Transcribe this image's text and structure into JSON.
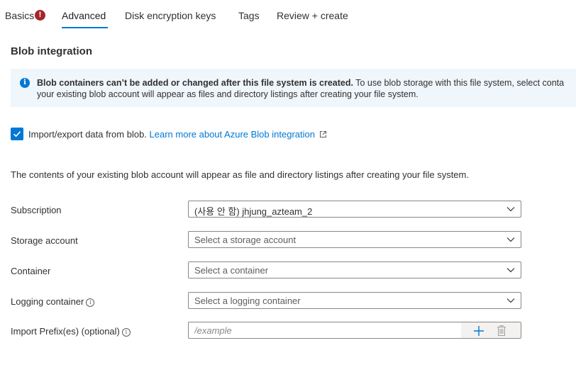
{
  "tabs": [
    {
      "label": "Basics",
      "has_error": true
    },
    {
      "label": "Advanced",
      "selected": true
    },
    {
      "label": "Disk encryption keys"
    },
    {
      "label": "Tags"
    },
    {
      "label": "Review + create"
    }
  ],
  "error_badge": "!",
  "section_title": "Blob integration",
  "banner": {
    "icon": "info-icon",
    "bold_text": "Blob containers can’t be added or changed after this file system is created.",
    "text_line1": " To use blob storage with this file system, select conta",
    "text_line2": "your existing blob account will appear as files and directory listings after creating your file system."
  },
  "import_export": {
    "checked": true,
    "label": "Import/export data from blob. ",
    "link": "Learn more about Azure Blob integration"
  },
  "description": "The contents of your existing blob account will appear as file and directory listings after creating your file system.",
  "form": {
    "subscription": {
      "label": "Subscription",
      "value": "(사용 안 함) jhjung_azteam_2"
    },
    "storage_account": {
      "label": "Storage account",
      "placeholder": "Select a storage account"
    },
    "container": {
      "label": "Container",
      "placeholder": "Select a container"
    },
    "logging_container": {
      "label": "Logging container",
      "placeholder": "Select a logging container"
    },
    "import_prefix": {
      "label": "Import Prefix(es) (optional)",
      "placeholder": "/example",
      "value": ""
    }
  },
  "colors": {
    "accent": "#0078d4",
    "error": "#a4262c",
    "banner_bg": "#eff6fc"
  }
}
